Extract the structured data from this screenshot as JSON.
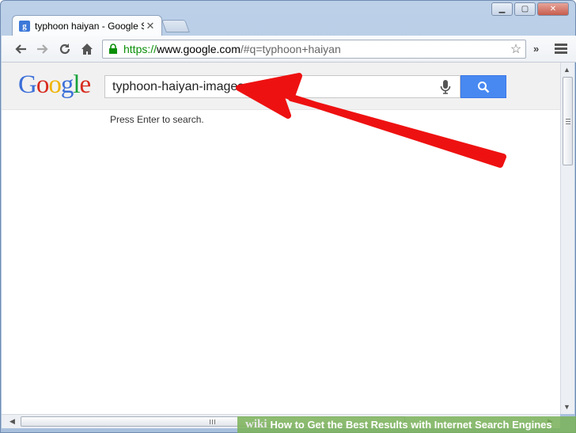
{
  "browser": {
    "tab_title": "typhoon haiyan - Google S",
    "tab_favicon": "g",
    "url_scheme": "https://",
    "url_host": "www.google.com",
    "url_path": "/#q=typhoon+haiyan",
    "overflow_chevron": "»"
  },
  "google": {
    "logo_letters": [
      {
        "ch": "G",
        "color": "#3b6fd8"
      },
      {
        "ch": "o",
        "color": "#d72b1f"
      },
      {
        "ch": "o",
        "color": "#f0b400"
      },
      {
        "ch": "g",
        "color": "#3b6fd8"
      },
      {
        "ch": "l",
        "color": "#16a23a"
      },
      {
        "ch": "e",
        "color": "#d72b1f"
      }
    ],
    "query": "typhoon-haiyan-images",
    "hint": "Press Enter to search."
  },
  "watermark": {
    "logo": "wiki",
    "text": "How to Get the Best Results with Internet Search Engines"
  },
  "annotation": {
    "arrow_color": "#ee1111"
  }
}
